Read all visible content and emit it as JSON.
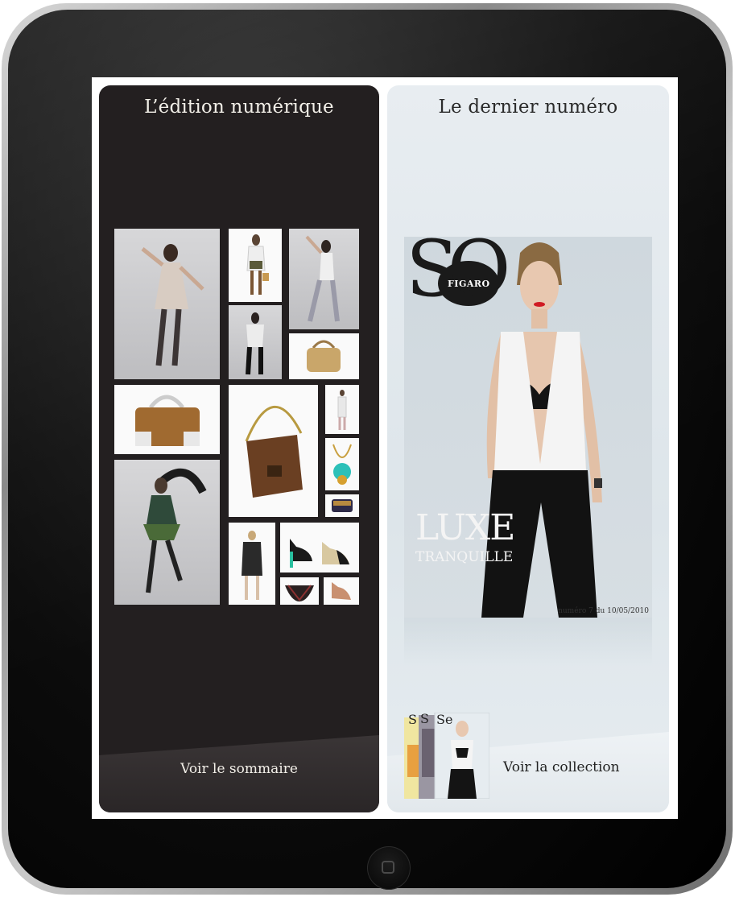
{
  "left_panel": {
    "title": "L’édition numérique",
    "button_label": "Voir le sommaire",
    "background_color": "#231f20"
  },
  "right_panel": {
    "title": "Le dernier numéro",
    "button_label": "Voir la collection",
    "background_color": "#e3e9ed"
  },
  "cover": {
    "masthead": "SO",
    "masthead_sub": "FIGARO",
    "headline": "LUXE",
    "subheadline": "TRANQUILLE",
    "issue_line": "numéro 7 du 10/05/2010"
  },
  "icons": {
    "home_button": "home-button-icon"
  }
}
